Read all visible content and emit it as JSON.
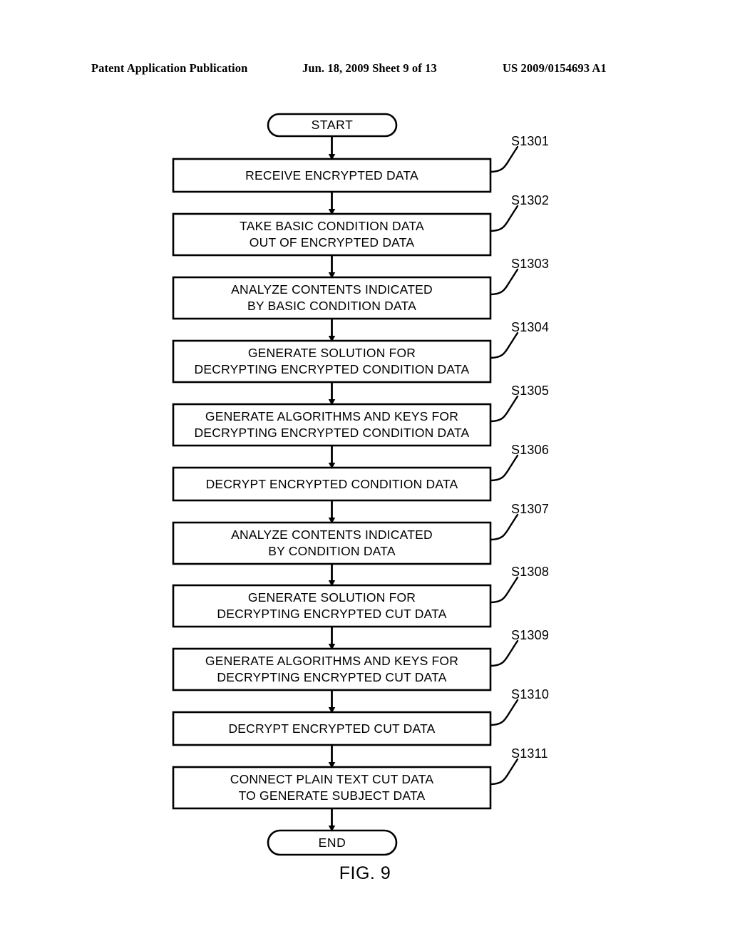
{
  "header": {
    "left": "Patent Application Publication",
    "middle": "Jun. 18, 2009  Sheet 9 of 13",
    "right": "US 2009/0154693 A1"
  },
  "figure": {
    "caption": "FIG. 9",
    "start_label": "START",
    "end_label": "END",
    "steps": [
      {
        "id": "S1301",
        "lines": [
          "RECEIVE ENCRYPTED DATA"
        ]
      },
      {
        "id": "S1302",
        "lines": [
          "TAKE BASIC CONDITION DATA",
          "OUT OF ENCRYPTED DATA"
        ]
      },
      {
        "id": "S1303",
        "lines": [
          "ANALYZE CONTENTS INDICATED",
          "BY BASIC CONDITION DATA"
        ]
      },
      {
        "id": "S1304",
        "lines": [
          "GENERATE SOLUTION FOR",
          "DECRYPTING ENCRYPTED CONDITION DATA"
        ]
      },
      {
        "id": "S1305",
        "lines": [
          "GENERATE ALGORITHMS AND KEYS FOR",
          "DECRYPTING ENCRYPTED CONDITION DATA"
        ]
      },
      {
        "id": "S1306",
        "lines": [
          "DECRYPT ENCRYPTED CONDITION DATA"
        ]
      },
      {
        "id": "S1307",
        "lines": [
          "ANALYZE CONTENTS INDICATED",
          "BY CONDITION DATA"
        ]
      },
      {
        "id": "S1308",
        "lines": [
          "GENERATE SOLUTION FOR",
          "DECRYPTING ENCRYPTED CUT DATA"
        ]
      },
      {
        "id": "S1309",
        "lines": [
          "GENERATE ALGORITHMS AND KEYS FOR",
          "DECRYPTING ENCRYPTED CUT DATA"
        ]
      },
      {
        "id": "S1310",
        "lines": [
          "DECRYPT ENCRYPTED CUT DATA"
        ]
      },
      {
        "id": "S1311",
        "lines": [
          "CONNECT PLAIN TEXT CUT DATA",
          "TO GENERATE SUBJECT DATA"
        ]
      }
    ]
  },
  "colors": {
    "ink": "#000000",
    "paper": "#ffffff"
  }
}
